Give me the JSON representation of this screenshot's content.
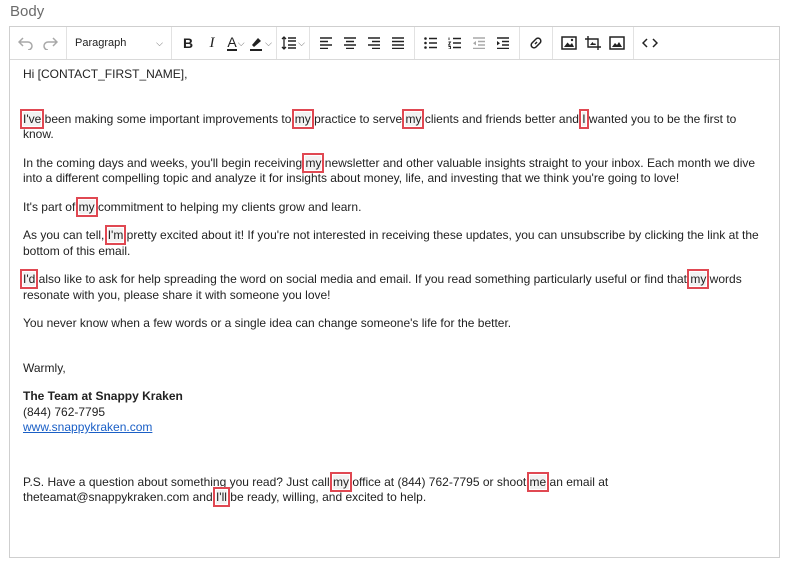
{
  "field_label": "Body",
  "toolbar": {
    "format_select": "Paragraph"
  },
  "email": {
    "greeting": "Hi [CONTACT_FIRST_NAME],",
    "p1": [
      {
        "t": "I've",
        "h": true
      },
      {
        "t": " been making some important improvements to "
      },
      {
        "t": "my",
        "h": true
      },
      {
        "t": " practice to serve "
      },
      {
        "t": "my",
        "h": true
      },
      {
        "t": " clients and friends better and "
      },
      {
        "t": "I",
        "h": true
      },
      {
        "t": " wanted you to be the first to know."
      }
    ],
    "p2": [
      {
        "t": "In the coming days and weeks, you'll begin receiving "
      },
      {
        "t": "my",
        "h": true
      },
      {
        "t": " newsletter and other valuable insights straight to your inbox. Each month we dive into a different compelling topic and analyze it for insights about money, life, and investing that we think you're going to love!"
      }
    ],
    "p3": [
      {
        "t": "It's part of "
      },
      {
        "t": "my",
        "h": true
      },
      {
        "t": " commitment to helping my clients grow and learn."
      }
    ],
    "p4": [
      {
        "t": "As you can tell, "
      },
      {
        "t": "I'm",
        "h": true
      },
      {
        "t": " pretty excited about it! If you're not interested in receiving these updates, you can unsubscribe by clicking the link at the bottom of this email."
      }
    ],
    "p5": [
      {
        "t": "I'd",
        "h": true
      },
      {
        "t": " also like to ask for help spreading the word on social media and email. If you read something particularly useful or find that "
      },
      {
        "t": "my",
        "h": true
      },
      {
        "t": " words resonate with you, please share it with someone you love!"
      }
    ],
    "p6": "You never know when a few words or a single idea can change someone's life for the better.",
    "closing": "Warmly,",
    "signature_name": "The Team at Snappy Kraken",
    "signature_phone": "(844) 762-7795",
    "signature_link": "www.snappykraken.com",
    "ps": [
      {
        "t": "P.S. Have a question about something you read? Just call "
      },
      {
        "t": "my",
        "h": true
      },
      {
        "t": " office at (844) 762-7795 or shoot "
      },
      {
        "t": "me",
        "h": true
      },
      {
        "t": " an email at theteamat@snappykraken.com and "
      },
      {
        "t": "I'll",
        "h": true
      },
      {
        "t": " be ready, willing, and excited to help."
      }
    ]
  },
  "colors": {
    "highlight_border": "#e04852",
    "link": "#1a5fc6"
  }
}
